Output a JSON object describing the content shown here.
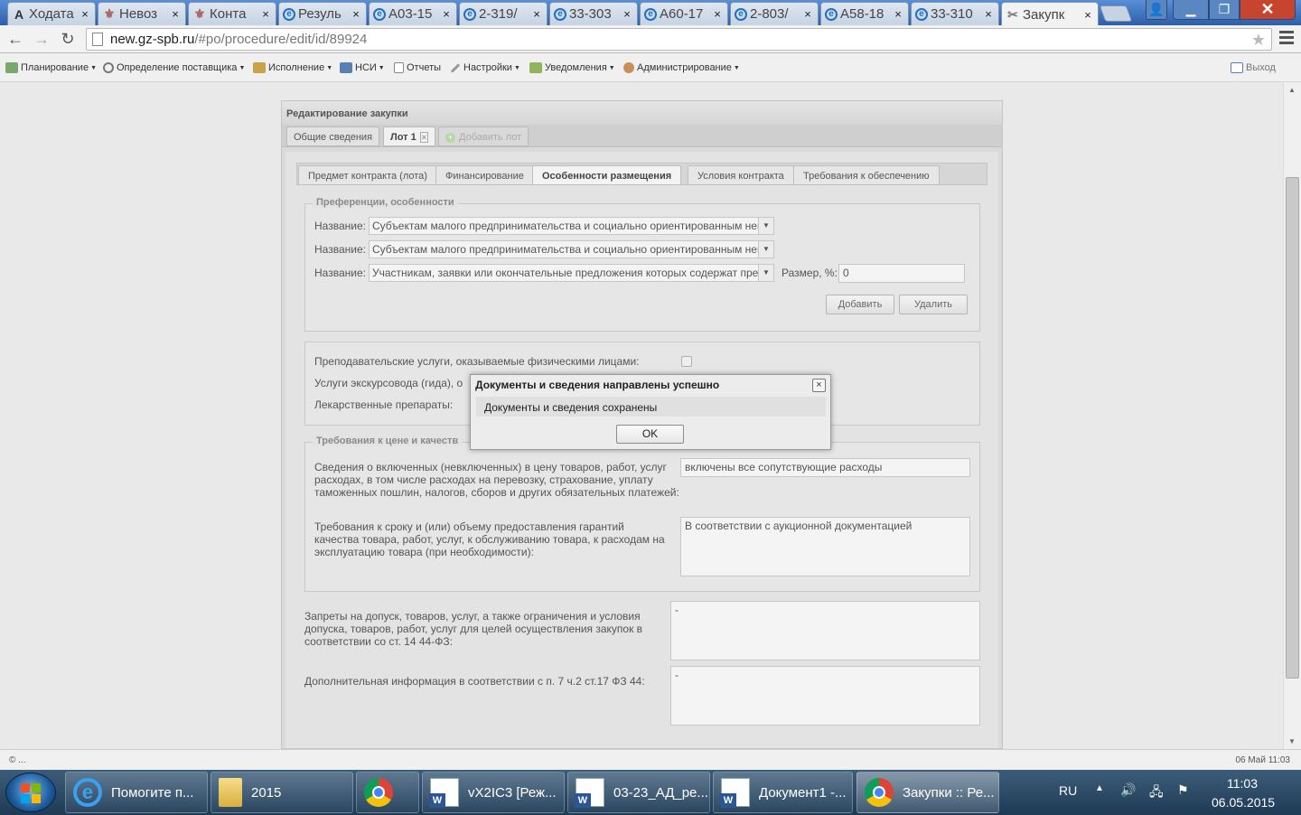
{
  "browser": {
    "tabs": [
      {
        "label": "Ходата",
        "icon": "A"
      },
      {
        "label": "Невоз",
        "icon": "seal"
      },
      {
        "label": "Конта",
        "icon": "seal"
      },
      {
        "label": "Резуль",
        "icon": "e"
      },
      {
        "label": "А03-15",
        "icon": "e"
      },
      {
        "label": "2-319/",
        "icon": "e"
      },
      {
        "label": "33-303",
        "icon": "e"
      },
      {
        "label": "А60-17",
        "icon": "e"
      },
      {
        "label": "2-803/",
        "icon": "e"
      },
      {
        "label": "А58-18",
        "icon": "e"
      },
      {
        "label": "33-310",
        "icon": "e"
      },
      {
        "label": "Закупк",
        "icon": "tools"
      }
    ],
    "close_glyph": "×",
    "url_host": "new.gz-spb.ru",
    "url_path": "/#po/procedure/edit/id/89924"
  },
  "app_menu": {
    "items": [
      "Планирование",
      "Определение поставщика",
      "Исполнение",
      "НСИ",
      "Отчеты",
      "Настройки",
      "Уведомления",
      "Администрирование"
    ],
    "exit": "Выход"
  },
  "panel": {
    "title": "Редактирование закупки",
    "top_tabs": {
      "general": "Общие сведения",
      "lot": "Лот 1",
      "add_lot": "Добавить лот"
    },
    "sub_tabs": [
      "Предмет контракта (лота)",
      "Финансирование",
      "Особенности размещения",
      "Условия контракта",
      "Требования к обеспечению"
    ],
    "preferences": {
      "legend": "Преференции, особенности",
      "name_label": "Название:",
      "rows": [
        "Субъектам малого предпринимательства и социально ориентированным некоммерческим организациям",
        "Субъектам малого предпринимательства и социально ориентированным некоммерческим организациям",
        "Участникам, заявки или окончательные предложения которых содержат предложения о поставке товаров"
      ],
      "size_label": "Размер, %:",
      "size_value": "0",
      "add_button": "Добавить",
      "delete_button": "Удалить"
    },
    "services": {
      "teaching": "Преподавательские услуги, оказываемые физическими лицами:",
      "guide": "Услуги экскурсовода (гида), о",
      "drugs": "Лекарственные препараты:"
    },
    "price_req": {
      "legend": "Требования к цене и качеств",
      "included_label": "Сведения о включенных (невключенных) в цену товаров, работ, услуг расходах, в том числе расходах на перевозку, страхование, уплату таможенных пошлин, налогов, сборов и других обязательных платежей:",
      "included_value": "включены все сопутствующие расходы",
      "guarantee_label": "Требования к сроку и (или) объему предоставления гарантий качества товара, работ, услуг, к обслуживанию товара, к расходам на эксплуатацию товара (при необходимости):",
      "guarantee_value": "В соответствии с аукционной документацией"
    },
    "bans_label": "Запреты на допуск, товаров, услуг, а также ограничения и условия допуска, товаров, работ, услуг для целей осуществления закупок в соответствии со ст. 14 44-ФЗ:",
    "bans_value": "-",
    "extra_label": "Дополнительная информация в соответствии с п. 7 ч.2 ст.17 ФЗ 44:",
    "extra_value": "-"
  },
  "dialog": {
    "title": "Документы и сведения направлены успешно",
    "message": "Документы и сведения сохранены",
    "ok": "OK",
    "close_glyph": "×"
  },
  "status": {
    "left": "© ...",
    "right": "06 Май 11:03"
  },
  "taskbar": {
    "items": [
      "Помогите п...",
      "2015",
      "",
      "vX2IC3 [Реж...",
      "03-23_АД_ре...",
      "Документ1 -...",
      "Закупки :: Ре..."
    ],
    "lang": "RU",
    "time": "11:03",
    "date": "06.05.2015"
  },
  "colors": {
    "accent": "#3a6fb6",
    "close": "#c9442f"
  }
}
